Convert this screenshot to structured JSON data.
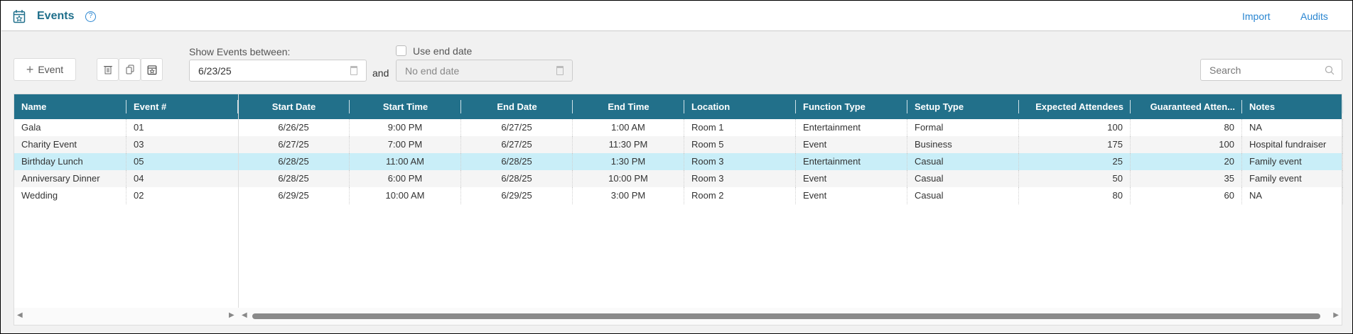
{
  "header": {
    "title": "Events",
    "help": "?",
    "links": [
      "Import",
      "Audits"
    ]
  },
  "toolbar": {
    "add_event_label": "Event",
    "add_icon": "+",
    "show_between_label": "Show Events between:",
    "start_date": "6/23/25",
    "and_label": "and",
    "use_end_date_label": "Use end date",
    "use_end_date_checked": false,
    "end_date_placeholder": "No end date",
    "search_placeholder": "Search"
  },
  "table": {
    "columns": [
      "Name",
      "Event #",
      "Start Date",
      "Start Time",
      "End Date",
      "End Time",
      "Location",
      "Function Type",
      "Setup Type",
      "Expected Attendees",
      "Guaranteed Atten...",
      "Notes"
    ],
    "rows": [
      [
        "Gala",
        "01",
        "6/26/25",
        "9:00 PM",
        "6/27/25",
        "1:00 AM",
        "Room 1",
        "Entertainment",
        "Formal",
        "100",
        "80",
        "NA"
      ],
      [
        "Charity Event",
        "03",
        "6/27/25",
        "7:00 PM",
        "6/27/25",
        "11:30 PM",
        "Room 5",
        "Event",
        "Business",
        "175",
        "100",
        "Hospital fundraiser"
      ],
      [
        "Birthday Lunch",
        "05",
        "6/28/25",
        "11:00 AM",
        "6/28/25",
        "1:30 PM",
        "Room 3",
        "Entertainment",
        "Casual",
        "25",
        "20",
        "Family event"
      ],
      [
        "Anniversary Dinner",
        "04",
        "6/28/25",
        "6:00 PM",
        "6/28/25",
        "10:00 PM",
        "Room 3",
        "Event",
        "Casual",
        "50",
        "35",
        "Family event"
      ],
      [
        "Wedding",
        "02",
        "6/29/25",
        "10:00 AM",
        "6/29/25",
        "3:00 PM",
        "Room 2",
        "Event",
        "Casual",
        "80",
        "60",
        "NA"
      ]
    ],
    "selected_row": 2
  },
  "colors": {
    "header": "#22708a",
    "selected": "#c9eef8",
    "link": "#2a86d1"
  }
}
